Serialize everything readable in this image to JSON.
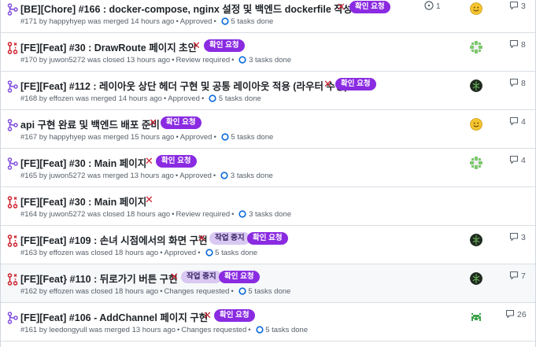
{
  "pull_requests": [
    {
      "title": "[BE][Chore] #166 : docker-compose, nginx 설정 및 백엔드 dockerfile 작성",
      "number": "#171",
      "author": "happyhyep",
      "action": "was merged",
      "time": "14 hours ago",
      "review": "Approved",
      "tasks": "5 tasks done",
      "labels": [
        "확인 요청"
      ],
      "linked_issues": "1",
      "comments": "3",
      "state": "merged",
      "avatar": "smiley"
    },
    {
      "title": "[FE][Feat] #30 : DrawRoute 페이지 초안",
      "number": "#170",
      "author": "juwon5272",
      "action": "was closed",
      "time": "13 hours ago",
      "review": "Review required",
      "tasks": "3 tasks done",
      "labels": [
        "확인 요청"
      ],
      "linked_issues": "",
      "comments": "8",
      "state": "closed",
      "avatar": "green-pattern"
    },
    {
      "title": "[FE][Feat] #112 : 레이아웃 상단 헤더 구현 및 공통 레이아웃 적용 (라우터 수정)",
      "number": "#168",
      "author": "effozen",
      "action": "was merged",
      "time": "14 hours ago",
      "review": "Approved",
      "tasks": "5 tasks done",
      "labels": [
        "확인 요청"
      ],
      "linked_issues": "",
      "comments": "8",
      "state": "merged",
      "avatar": "dark-circle"
    },
    {
      "title": "api 구현 완료 및 백엔드 배포 준비",
      "number": "#167",
      "author": "happyhyep",
      "action": "was merged",
      "time": "15 hours ago",
      "review": "Approved",
      "tasks": "5 tasks done",
      "labels": [
        "확인 요청"
      ],
      "linked_issues": "",
      "comments": "4",
      "state": "merged",
      "avatar": "smiley"
    },
    {
      "title": "[FE][Feat] #30 : Main 페이지",
      "number": "#165",
      "author": "juwon5272",
      "action": "was merged",
      "time": "13 hours ago",
      "review": "Approved",
      "tasks": "3 tasks done",
      "labels": [
        "확인 요청"
      ],
      "linked_issues": "",
      "comments": "4",
      "state": "merged",
      "avatar": "green-pattern"
    },
    {
      "title": "[FE][Feat] #30 : Main 페이지",
      "number": "#164",
      "author": "juwon5272",
      "action": "was closed",
      "time": "18 hours ago",
      "review": "Review required",
      "tasks": "3 tasks done",
      "labels": [],
      "linked_issues": "",
      "comments": "",
      "state": "closed",
      "avatar": ""
    },
    {
      "title": "[FE][Feat] #109 : 손녀 시점에서의 화면 구현",
      "number": "#163",
      "author": "effozen",
      "action": "was closed",
      "time": "18 hours ago",
      "review": "Approved",
      "tasks": "5 tasks done",
      "labels": [
        "작업 중지",
        "확인 요청"
      ],
      "linked_issues": "",
      "comments": "3",
      "state": "closed",
      "avatar": "dark-circle"
    },
    {
      "title": "[FE][Feat} #110 : 뒤로가기 버튼 구현",
      "number": "#162",
      "author": "effozen",
      "action": "was closed",
      "time": "18 hours ago",
      "review": "Changes requested",
      "tasks": "5 tasks done",
      "labels": [
        "작업 중지",
        "확인 요청"
      ],
      "linked_issues": "",
      "comments": "7",
      "state": "closed",
      "avatar": "dark-circle"
    },
    {
      "title": "[FE][Feat] #106 - AddChannel 페이지 구현",
      "number": "#161",
      "author": "leedongyull",
      "action": "was merged",
      "time": "13 hours ago",
      "review": "Changes requested",
      "tasks": "5 tasks done",
      "labels": [
        "확인 요청"
      ],
      "linked_issues": "",
      "comments": "26",
      "state": "merged",
      "avatar": "invader"
    }
  ],
  "colors": {
    "merged": "#8250df",
    "closed": "#cf222e",
    "label_request": "#8a2be2",
    "label_stop": "#d8c8f2",
    "check_fail": "#cf222e",
    "task_ring": "#0969da"
  },
  "icons": {
    "merged": "git-merge-icon",
    "closed": "git-pull-request-closed-icon",
    "check_fail": "x-icon",
    "tasks": "progress-circle-icon",
    "linked_issue": "issue-opened-icon",
    "comments": "comment-icon"
  }
}
